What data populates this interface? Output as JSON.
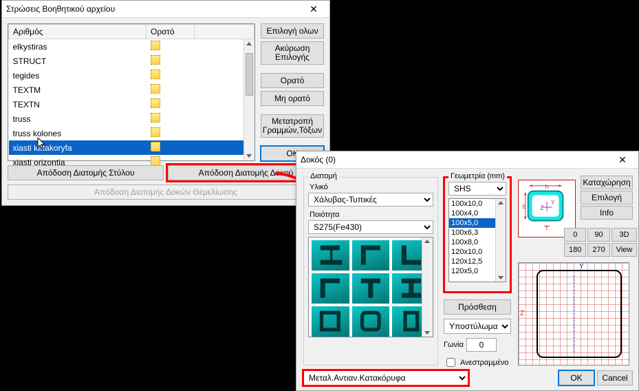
{
  "dlg_layers": {
    "title": "Στρώσεις Βοηθητικού αρχείου",
    "columns": {
      "number": "Αριθμός",
      "visible": "Ορατό"
    },
    "rows": [
      {
        "name": "elkystiras",
        "selected": false
      },
      {
        "name": "STRUCT",
        "selected": false
      },
      {
        "name": "tegides",
        "selected": false
      },
      {
        "name": "TEXTM",
        "selected": false
      },
      {
        "name": "TEXTN",
        "selected": false
      },
      {
        "name": "truss",
        "selected": false
      },
      {
        "name": "truss kolones",
        "selected": false
      },
      {
        "name": "xiasti katakoryfa",
        "selected": true
      },
      {
        "name": "xiasti orizontia",
        "selected": false
      }
    ],
    "side": {
      "select_all": "Επιλογή ολων",
      "cancel_sel": "Ακύρωση Επιλογής",
      "visible": "Ορατό",
      "not_visible": "Μη ορατό",
      "convert": "Μετατροπή Γραμμών,Τόξων",
      "ok": "OK"
    },
    "bottom": {
      "assign_col": "Απόδοση Διατομής Στύλου",
      "assign_beam": "Απόδοση Διατομής Δοκού",
      "assign_found": "Απόδοση Διατομής Δοκών Θεμελίωσης"
    }
  },
  "dlg_beam": {
    "title": "Δοκός (0)",
    "section": {
      "group": "Διατομή",
      "material_label": "Υλικό",
      "material": "Χάλυβας-Τυπικές",
      "quality_label": "Ποιότητα",
      "quality": "S275(Fe430)"
    },
    "geometry": {
      "title": "Γεωμετρία (mm)",
      "shape": "SHS",
      "items": [
        "100x10,0",
        "100x4,0",
        "100x5,0",
        "100x6,3",
        "100x8,0",
        "120x10,0",
        "120x12,5",
        "120x5,0"
      ],
      "selected_index": 2
    },
    "mid": {
      "add": "Πρόσθεση",
      "member": "Υποστύλωμα",
      "angle_label": "Γωνία",
      "angle": "0",
      "flipped": "Ανεστραμμένο"
    },
    "preview_axes": {
      "h": "h",
      "b": "b",
      "y": "Y",
      "z": "Z",
      "t": "t"
    },
    "big_preview": {
      "z": "Z",
      "y": "Y"
    },
    "right": {
      "register": "Καταχώρηση",
      "select": "Επιλογή",
      "info": "Info",
      "b0": "0",
      "b90": "90",
      "b3d": "3D",
      "b180": "180",
      "b270": "270",
      "bview": "View"
    },
    "layer_select": "Μεταλ.Αντιαν.Κατακόρυφα",
    "ok": "OK",
    "cancel": "Cancel"
  }
}
